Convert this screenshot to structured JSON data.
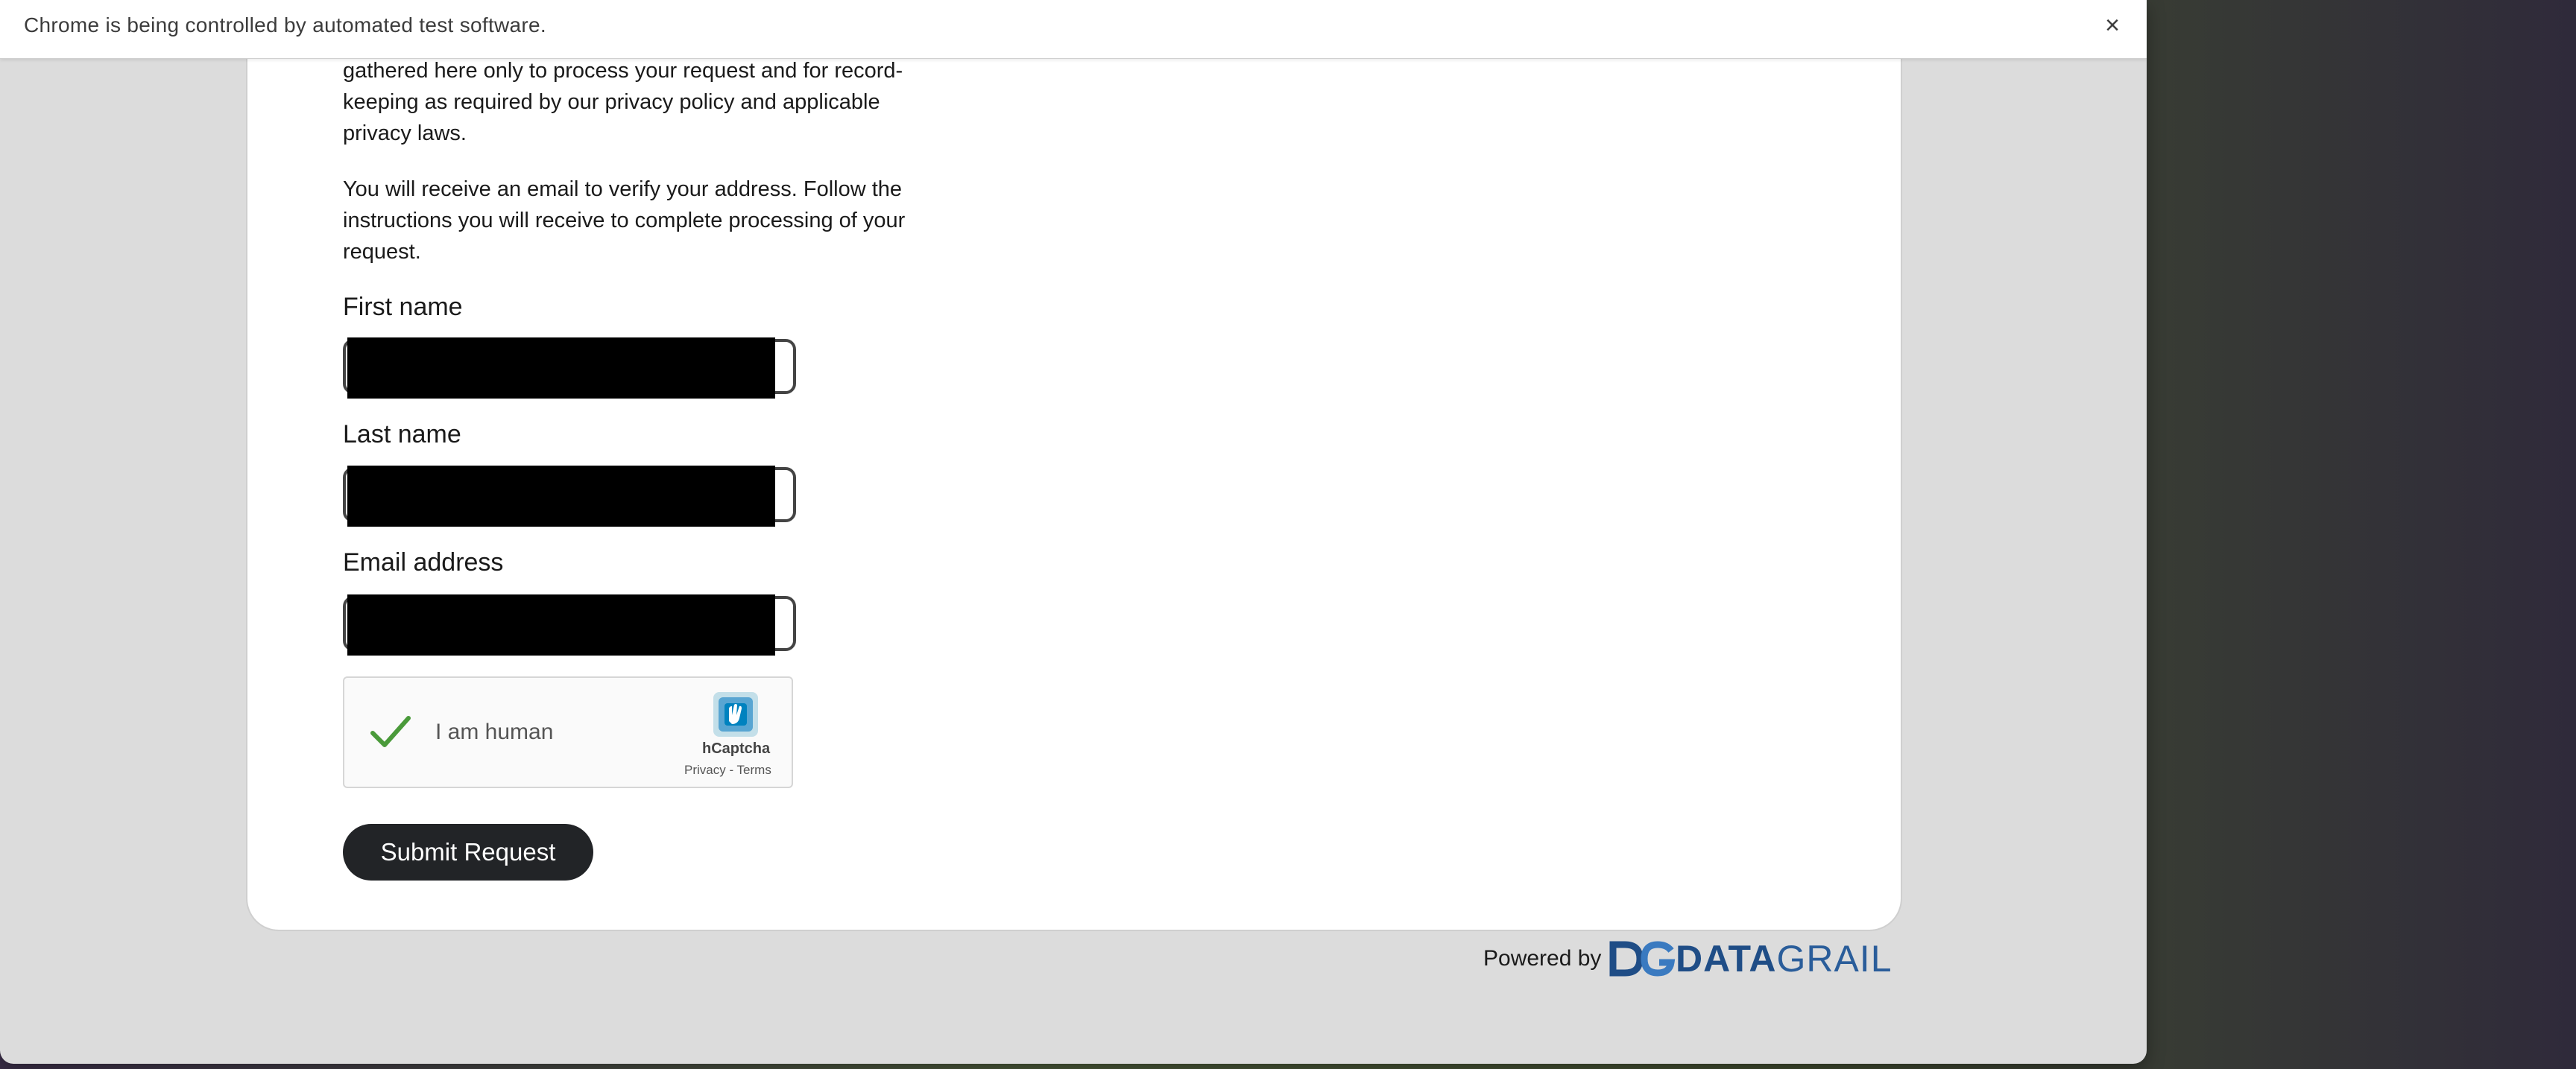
{
  "infobar": {
    "message": "Chrome is being controlled by automated test software.",
    "close_label": "×"
  },
  "page": {
    "para1": "gathered here only to process your request and for record-keeping as required by our privacy policy and applicable privacy laws.",
    "para2": "You will receive an email to verify your address. Follow the instructions you will receive to complete processing of your request.",
    "fields": {
      "first_name_label": "First name",
      "last_name_label": "Last name",
      "email_label": "Email address"
    },
    "captcha": {
      "label": "I am human",
      "brand": "hCaptcha",
      "privacy": "Privacy",
      "separator": " - ",
      "terms": "Terms"
    },
    "submit_label": "Submit Request"
  },
  "footer": {
    "powered_by": "Powered by",
    "brand_bold": "DATA",
    "brand_light": "GRAIL"
  },
  "colors": {
    "window_bg": "#dcdcdc",
    "button_bg": "#222427",
    "brand": "#1f4d86",
    "check": "#4a9a3a"
  }
}
